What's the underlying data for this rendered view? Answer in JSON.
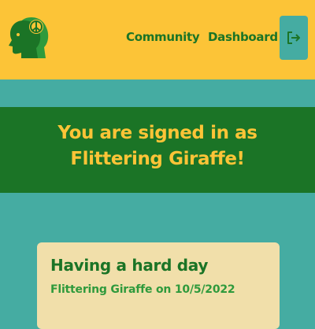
{
  "header": {
    "logo_icon": "head-peace-sign-icon",
    "nav": {
      "community_label": "Community",
      "dashboard_label": "Dashboard"
    },
    "logout_icon": "logout-icon"
  },
  "banner": {
    "line1": "You are signed in as",
    "line2": "Flittering Giraffe!"
  },
  "post": {
    "title": "Having a hard day",
    "meta": "Flittering Giraffe on 10/5/2022"
  },
  "colors": {
    "header_bg": "#fcc437",
    "page_bg": "#45aca2",
    "accent_green": "#1b7426",
    "card_bg": "#f1dfaa"
  }
}
